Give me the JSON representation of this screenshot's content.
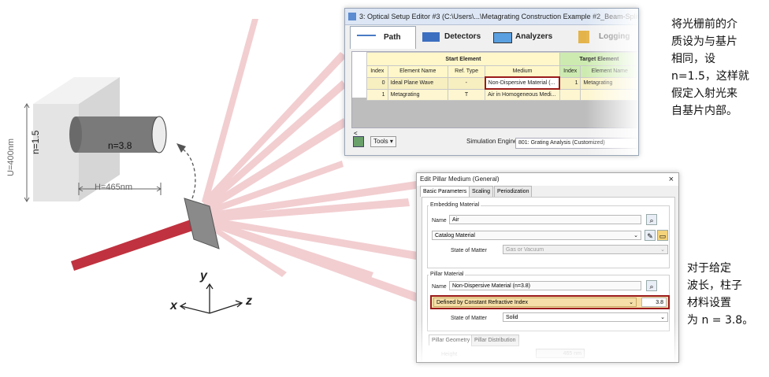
{
  "scene": {
    "material_label": "n=1.5",
    "height_label": "U=400nm",
    "width_label": "H=465nm",
    "cylinder_label": "n=3.8",
    "axis_y": "y",
    "axis_x": "x",
    "axis_z": "z",
    "colors": {
      "beam": "#c0323f",
      "beam_light": "#e8a7ad",
      "block": "#e4e4e4",
      "cylinder": "#7a7a7a",
      "plate": "#8a8a8a"
    }
  },
  "setup_window": {
    "title": "3: Optical Setup Editor #3 (C:\\Users\\...\\Metagrating Construction Example #2_Beam-Splitting (...",
    "tabs": [
      {
        "label": "Path",
        "icon": "path-icon"
      },
      {
        "label": "Detectors",
        "icon": "detectors-icon"
      },
      {
        "label": "Analyzers",
        "icon": "analyzers-icon"
      },
      {
        "label": "Logging",
        "icon": "logging-icon"
      }
    ],
    "start_group": "Start Element",
    "target_group": "Target Element",
    "columns": [
      "Index",
      "Element Name",
      "Ref. Type",
      "Medium",
      "Index",
      "Element Name"
    ],
    "rows": [
      [
        "0",
        "Ideal Plane Wave",
        "-",
        "Non-Dispersive Material (...",
        "1",
        "Metagrating"
      ],
      [
        "1",
        "Metagrating",
        "T",
        "Air in Homogeneous Medi...",
        "",
        ""
      ]
    ],
    "tools_label": "Tools",
    "engine_label": "Simulation Engine",
    "engine_value": "801: Grating Analysis (Customized)"
  },
  "dialog": {
    "title": "Edit Pillar Medium (General)",
    "close": "×",
    "tabs": [
      "Basic Parameters",
      "Scaling",
      "Periodization"
    ],
    "embedding_group": "Embedding Material",
    "name_label": "Name",
    "embedding_name": "Air",
    "catalog_value": "Catalog Material",
    "state_label": "State of Matter",
    "embedding_state": "Gas or Vacuum",
    "pillar_group": "Pillar Material",
    "pillar_name": "Non-Dispersive Material (n=3.8)",
    "pillar_definition": "Defined by Constant Refractive Index",
    "pillar_index": "3.8",
    "pillar_state": "Solid",
    "sub_tabs": [
      "Pillar Geometry",
      "Pillar Distribution"
    ],
    "height_label": "Height",
    "height_value": "465 nm"
  },
  "annotations": {
    "note_top": [
      "将光栅前的介",
      "质设为与基片",
      "相同，设",
      "n=1.5，这样就",
      "假定入射光来",
      "自基片内部。"
    ],
    "note_bottom": [
      "对于给定",
      "波长，柱子",
      "材料设置",
      "为 n = 3.8。"
    ]
  }
}
